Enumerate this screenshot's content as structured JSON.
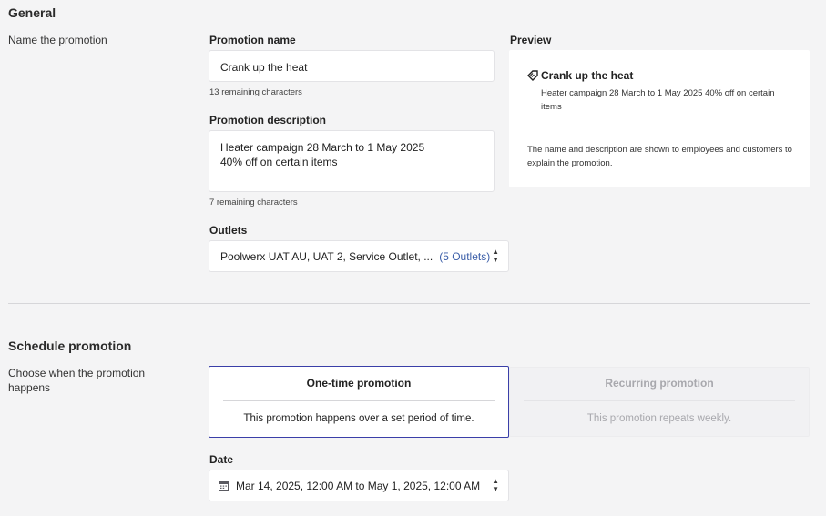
{
  "general": {
    "title": "General",
    "side_label": "Name the promotion",
    "promotion_name_label": "Promotion name",
    "promotion_name_value": "Crank up the heat",
    "promotion_name_hint": "13 remaining characters",
    "promotion_description_label": "Promotion description",
    "promotion_description_line1": "Heater campaign 28 March to 1 May 2025",
    "promotion_description_line2": "40% off on certain items",
    "promotion_description_hint": "7 remaining characters",
    "outlets_label": "Outlets",
    "outlets_value": "Poolwerx UAT AU, UAT 2, Service Outlet, ...",
    "outlets_count": "(5 Outlets)"
  },
  "preview": {
    "label": "Preview",
    "title": "Crank up the heat",
    "description": "Heater campaign 28 March to 1 May 2025 40% off on certain items",
    "note": "The name and description are shown to employees and customers to explain the promotion."
  },
  "schedule": {
    "title": "Schedule promotion",
    "side_label": "Choose when the promotion happens",
    "one_time_title": "One-time promotion",
    "one_time_desc": "This promotion happens over a set period of time.",
    "recurring_title": "Recurring promotion",
    "recurring_desc": "This promotion repeats weekly.",
    "selected": "One-time promotion",
    "date_label": "Date",
    "date_value": "Mar 14, 2025, 12:00 AM to May 1, 2025, 12:00 AM"
  },
  "colors": {
    "accent": "#3a3fa8",
    "link": "#3b5ea8",
    "disabled_text": "#a8a8ad"
  },
  "icons": [
    "tag-icon",
    "calendar-icon",
    "up-down-stepper-icon"
  ]
}
